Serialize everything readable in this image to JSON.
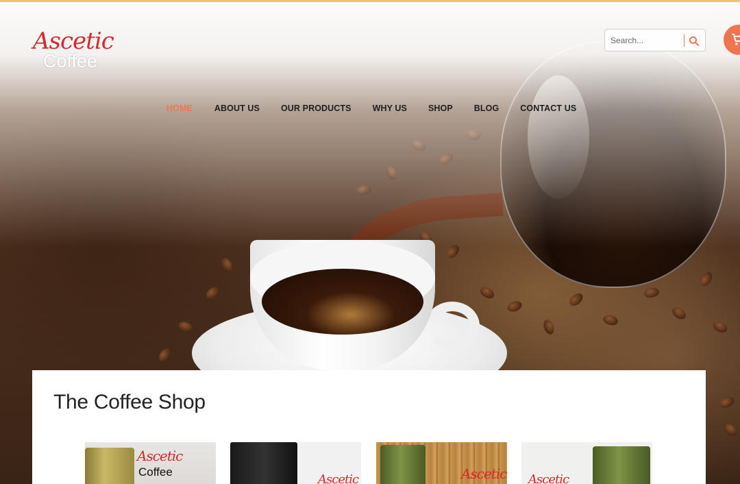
{
  "brand": {
    "logo_top": "Ascetic",
    "logo_bottom": "Coffee"
  },
  "search": {
    "placeholder": "Search..."
  },
  "cart": {
    "icon": "cart-icon"
  },
  "nav": {
    "items": [
      {
        "label": "HOME",
        "active": true
      },
      {
        "label": "ABOUT US"
      },
      {
        "label": "OUR PRODUCTS"
      },
      {
        "label": "WHY US"
      },
      {
        "label": "SHOP"
      },
      {
        "label": "BLOG"
      },
      {
        "label": "CONTACT US"
      }
    ]
  },
  "content": {
    "title": "The Coffee Shop",
    "products": [
      {
        "brand_script": "Ascetic",
        "brand_word": "Coffee"
      },
      {
        "brand_script": "Ascetic"
      },
      {
        "brand_script": "Ascetic"
      },
      {
        "brand_script": "Ascetic"
      }
    ]
  },
  "colors": {
    "accent": "#f0744d",
    "logo_red": "#d42a2a",
    "nav_text": "#1f1f1f"
  }
}
